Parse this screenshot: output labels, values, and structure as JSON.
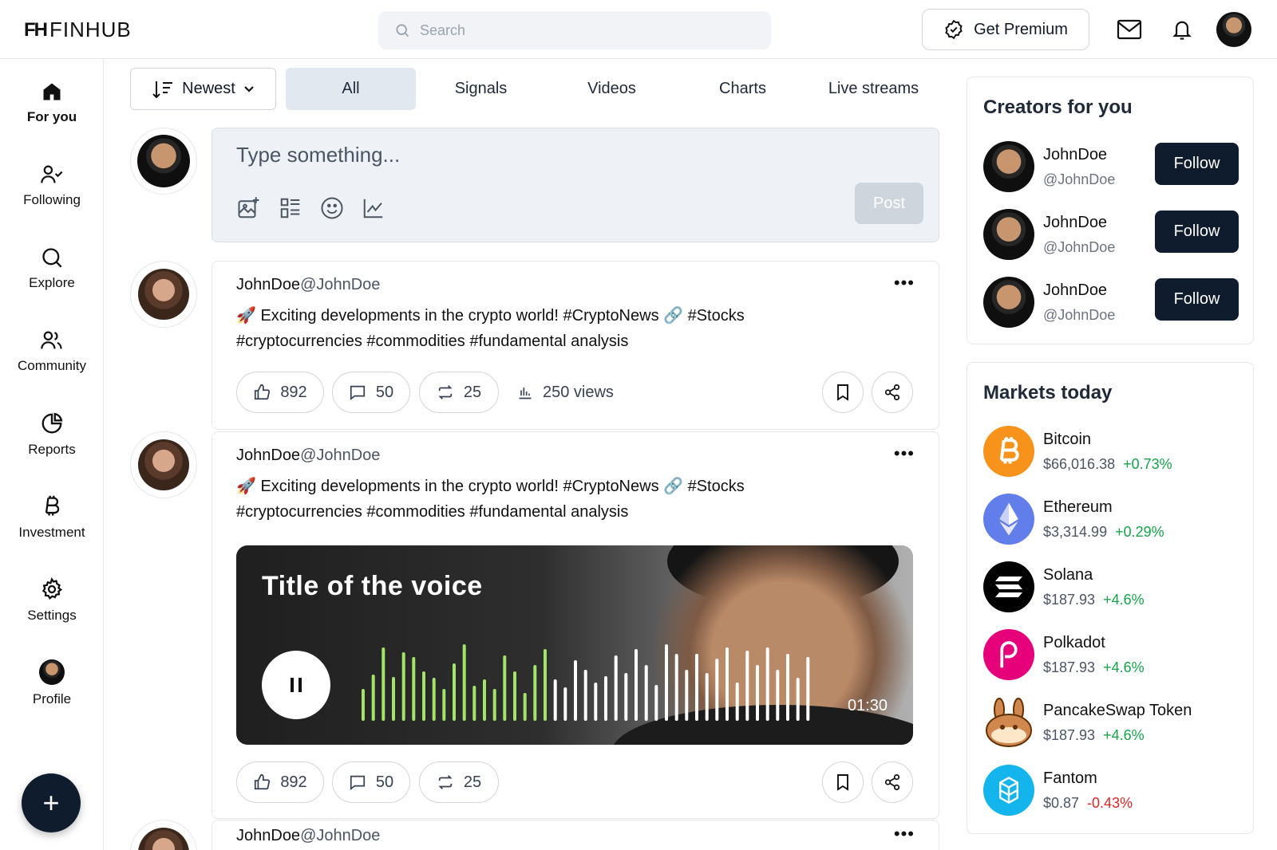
{
  "brand": {
    "name": "FINHUB",
    "mark": "FH"
  },
  "search": {
    "placeholder": "Search"
  },
  "header": {
    "premium_label": "Get Premium"
  },
  "sidebar": {
    "items": [
      {
        "label": "For you",
        "icon": "home-icon"
      },
      {
        "label": "Following",
        "icon": "user-check-icon"
      },
      {
        "label": "Explore",
        "icon": "search-icon"
      },
      {
        "label": "Community",
        "icon": "users-icon"
      },
      {
        "label": "Reports",
        "icon": "pie-chart-icon"
      },
      {
        "label": "Investment",
        "icon": "bitcoin-icon"
      },
      {
        "label": "Settings",
        "icon": "gear-icon"
      },
      {
        "label": "Profile",
        "icon": "avatar"
      }
    ],
    "fab": "+"
  },
  "feed": {
    "sort_label": "Newest",
    "tabs": [
      "All",
      "Signals",
      "Videos",
      "Charts",
      "Live streams"
    ],
    "composer": {
      "placeholder": "Type something...",
      "post_label": "Post"
    },
    "posts": [
      {
        "name": "JohnDoe",
        "handle": "@JohnDoe",
        "text": "🚀 Exciting developments in the crypto world! #CryptoNews 🔗  #Stocks #cryptocurrencies #commodities #fundamental analysis",
        "likes": "892",
        "comments": "50",
        "reposts": "25",
        "views": "250 views"
      },
      {
        "name": "JohnDoe",
        "handle": "@JohnDoe",
        "text": "🚀 Exciting developments in the crypto world! #CryptoNews 🔗  #Stocks #cryptocurrencies #commodities #fundamental analysis",
        "voice": {
          "title": "Title of the voice",
          "time": "01:30",
          "progress": 0.41
        },
        "likes": "892",
        "comments": "50",
        "reposts": "25"
      },
      {
        "name": "JohnDoe",
        "handle": "@JohnDoe"
      }
    ]
  },
  "creators": {
    "title": "Creators for you",
    "items": [
      {
        "name": "JohnDoe",
        "handle": "@JohnDoe",
        "action": "Follow"
      },
      {
        "name": "JohnDoe",
        "handle": "@JohnDoe",
        "action": "Follow"
      },
      {
        "name": "JohnDoe",
        "handle": "@JohnDoe",
        "action": "Follow"
      }
    ]
  },
  "markets": {
    "title": "Markets today",
    "items": [
      {
        "name": "Bitcoin",
        "price": "$66,016.38",
        "change": "+0.73%",
        "color": "#f7931a"
      },
      {
        "name": "Ethereum",
        "price": "$3,314.99",
        "change": "+0.29%",
        "color": "#627eea"
      },
      {
        "name": "Solana",
        "price": "$187.93",
        "change": "+4.6%",
        "color": "#000000"
      },
      {
        "name": "Polkadot",
        "price": "$187.93",
        "change": "+4.6%",
        "color": "#e6007a"
      },
      {
        "name": "PancakeSwap Token",
        "price": "$187.93",
        "change": "+4.6%",
        "color": "#d1884f"
      },
      {
        "name": "Fantom",
        "price": "$0.87",
        "change": "-0.43%",
        "color": "#13b5ec"
      }
    ]
  },
  "colors": {
    "accent_dark": "#0f1c2e",
    "up": "#16a34a",
    "down": "#dc2626",
    "wave_played": "#a3e36a",
    "wave_rest": "#ffffff"
  }
}
